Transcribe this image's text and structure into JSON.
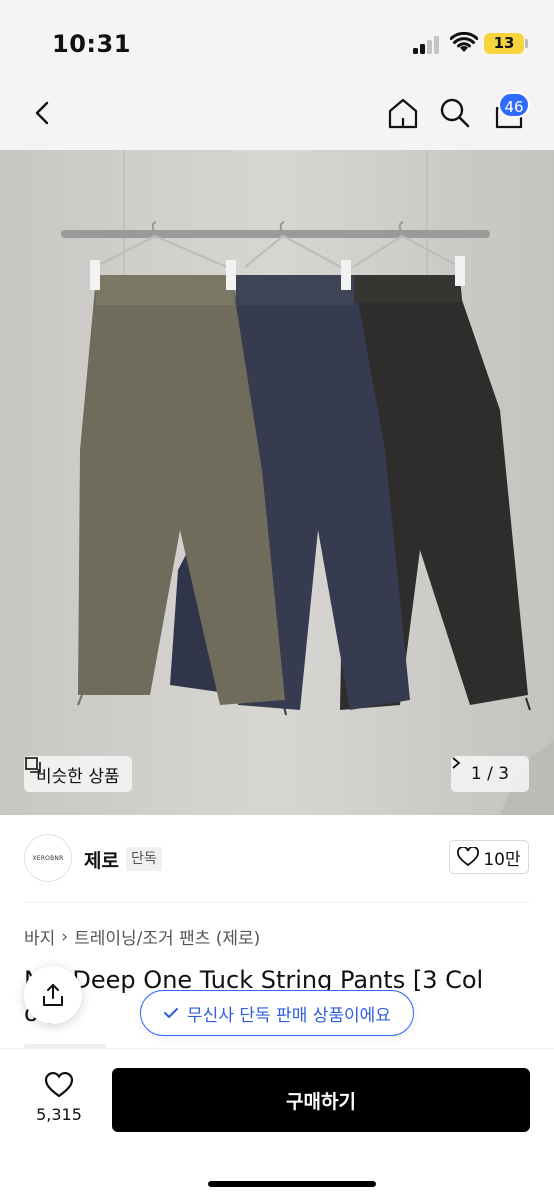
{
  "status": {
    "time": "10:31",
    "battery": "13"
  },
  "nav": {
    "cart_count": "46"
  },
  "gallery": {
    "similar_label": "비슷한 상품",
    "pager": "1 / 3"
  },
  "brand": {
    "logo_text": "XEROBNR",
    "name": "제로",
    "exclusive_tag": "단독",
    "likes": "10만"
  },
  "breadcrumb": [
    "바지",
    "트레이닝/조거 팬츠 (제로)"
  ],
  "product": {
    "title_line1": "N  n Deep One Tuck String Pants [3 Col",
    "title_line2": "o   ]"
  },
  "exclusive_notice": "무신사 단독 판매 상품이에요",
  "bottom": {
    "wish_count": "5,315",
    "buy_label": "구매하기"
  },
  "colors": {
    "accent": "#2f6bff",
    "buy_bg": "#000000"
  },
  "icons": [
    "back-icon",
    "home-icon",
    "search-icon",
    "cart-icon",
    "similar-icon",
    "chevron-right-icon",
    "heart-icon",
    "share-icon",
    "check-icon"
  ]
}
